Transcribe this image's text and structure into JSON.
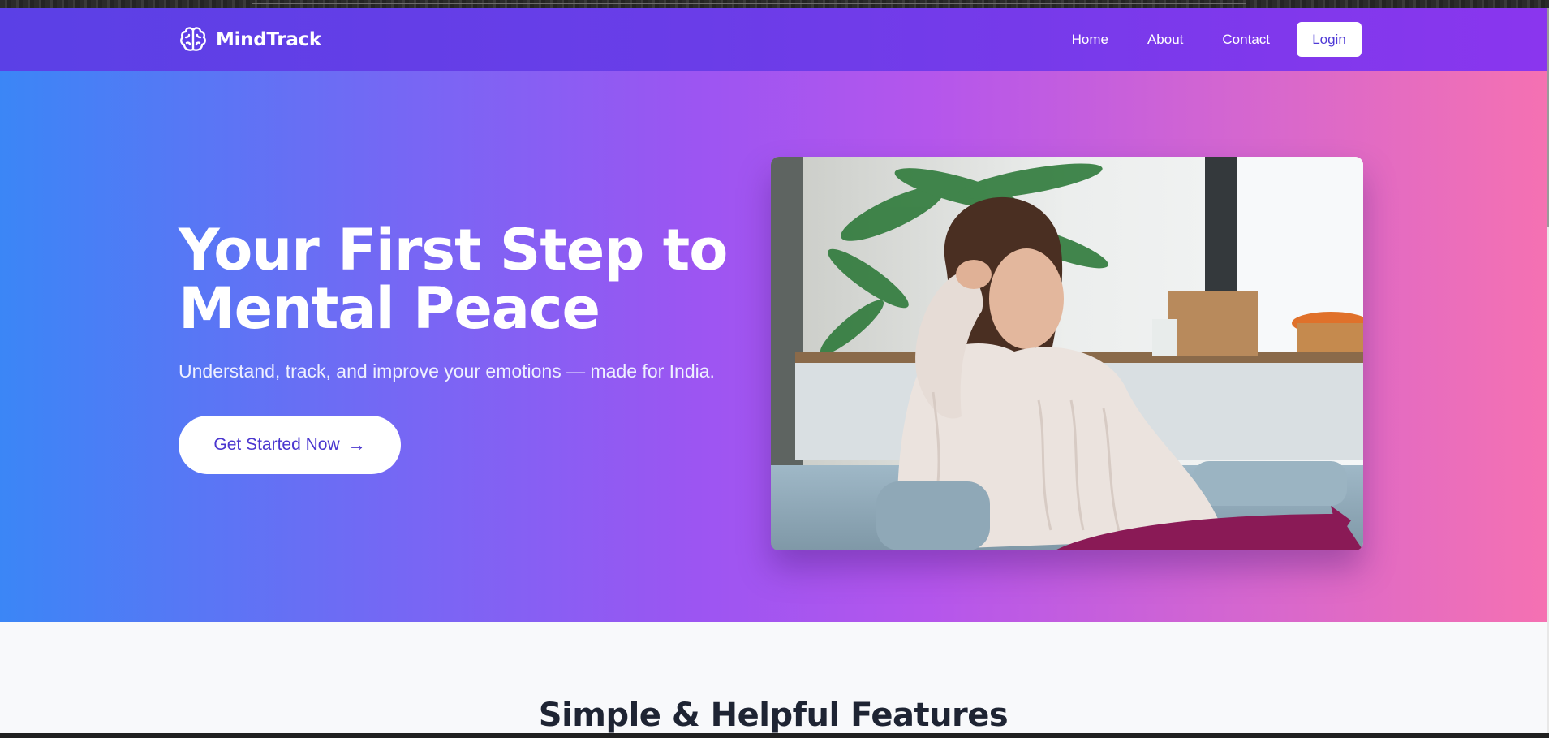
{
  "brand": {
    "name": "MindTrack",
    "icon": "brain-icon"
  },
  "nav": {
    "links": [
      "Home",
      "About",
      "Contact"
    ],
    "login_label": "Login"
  },
  "hero": {
    "title_line1": "Your First Step to",
    "title_line2": "Mental Peace",
    "subtitle": "Understand, track, and improve your emotions — made for India.",
    "cta_label": "Get Started Now",
    "cta_icon": "arrow-right-icon",
    "image": "woman-sitting-on-couch-photo"
  },
  "features": {
    "title": "Simple & Helpful Features"
  },
  "colors": {
    "nav_start": "#5b40e6",
    "nav_end": "#8a36ee",
    "hero_start": "#3b86f6",
    "hero_mid": "#9c55f2",
    "hero_end": "#f571b2",
    "accent_text": "#4a36cf"
  }
}
